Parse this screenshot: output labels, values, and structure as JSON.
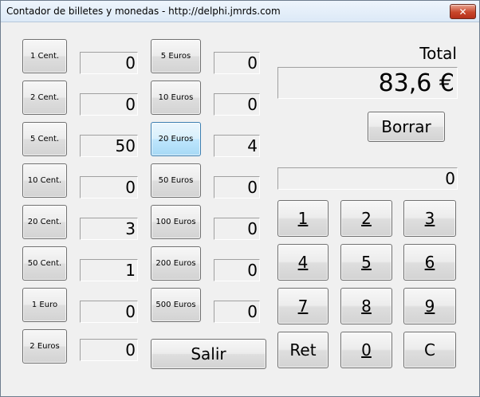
{
  "window": {
    "title": "Contador de billetes y monedas  - http://delphi.jmrds.com",
    "close_label": "✕"
  },
  "coins": [
    {
      "label": "1 Cent.",
      "count": "0"
    },
    {
      "label": "2 Cent.",
      "count": "0"
    },
    {
      "label": "5 Cent.",
      "count": "50"
    },
    {
      "label": "10 Cent.",
      "count": "0"
    },
    {
      "label": "20 Cent.",
      "count": "3"
    },
    {
      "label": "50 Cent.",
      "count": "1"
    },
    {
      "label": "1 Euro",
      "count": "0"
    },
    {
      "label": "2 Euros",
      "count": "0"
    }
  ],
  "notes": [
    {
      "label": "5 Euros",
      "count": "0"
    },
    {
      "label": "10 Euros",
      "count": "0"
    },
    {
      "label": "20 Euros",
      "count": "4"
    },
    {
      "label": "50 Euros",
      "count": "0"
    },
    {
      "label": "100 Euros",
      "count": "0"
    },
    {
      "label": "200 Euros",
      "count": "0"
    },
    {
      "label": "500 Euros",
      "count": "0"
    }
  ],
  "salir_label": "Salir",
  "total": {
    "label": "Total",
    "value": "83,6 €"
  },
  "borrar_label": "Borrar",
  "entry_value": "0",
  "keypad": {
    "k1": "1",
    "k2": "2",
    "k3": "3",
    "k4": "4",
    "k5": "5",
    "k6": "6",
    "k7": "7",
    "k8": "8",
    "k9": "9",
    "ret": "Ret",
    "k0": "0",
    "c": "C"
  },
  "colors": {
    "focus_border": "#3c7fb1",
    "close_button": "#c8462b"
  }
}
